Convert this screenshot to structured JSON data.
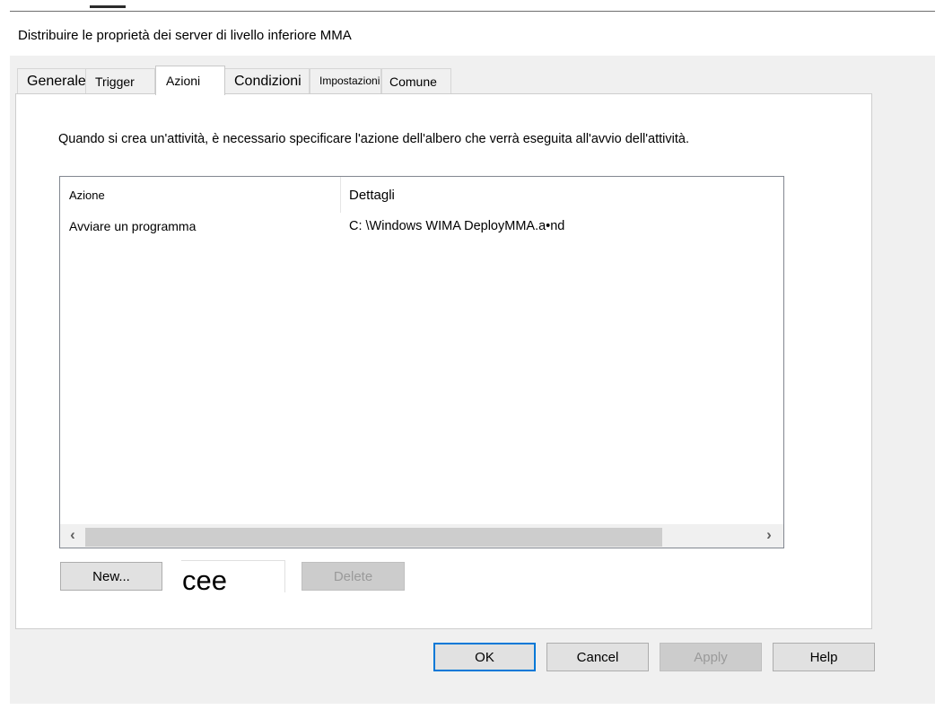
{
  "window": {
    "title": "Distribuire le proprietà dei server di livello inferiore MMA"
  },
  "tabs": [
    {
      "label": "Generale"
    },
    {
      "label": "Trigger"
    },
    {
      "label": "Azioni"
    },
    {
      "label": "Condizioni"
    },
    {
      "label": "Impostazioni"
    },
    {
      "label": "Comune"
    }
  ],
  "actions_panel": {
    "description": "Quando si crea un'attività, è necessario specificare l'azione dell'albero che verrà eseguita all'avvio dell'attività.",
    "columns": {
      "action": "Azione",
      "details": "Dettagli"
    },
    "rows": [
      {
        "action": "Avviare un programma",
        "details": "C: \\Windows WIMA DeployMMA.a•nd"
      }
    ],
    "new_label": "New...",
    "edit_text": "cee",
    "delete_label": "Delete"
  },
  "footer": {
    "ok_label": "OK",
    "cancel_label": "Cancel",
    "apply_label": "Apply",
    "help_label": "Help"
  },
  "icons": {
    "move_up": "triangle-up-icon",
    "move_down": "triangle-down-icon",
    "scroll_left": "chevron-left-icon",
    "scroll_right": "chevron-right-icon"
  }
}
